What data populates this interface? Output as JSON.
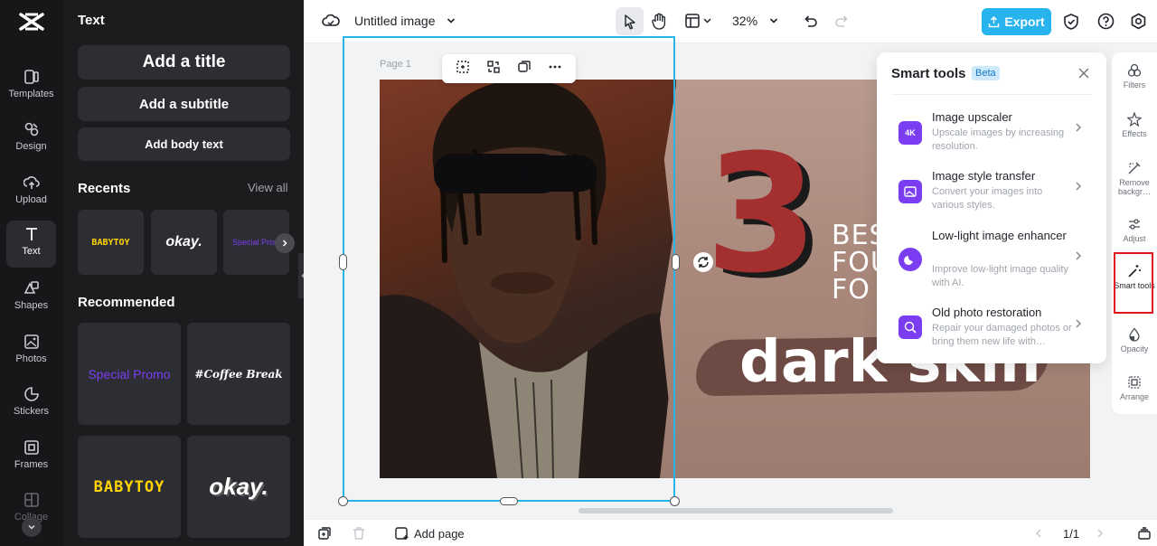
{
  "left_rail": {
    "items": [
      {
        "label": "Templates",
        "icon": "templates-icon"
      },
      {
        "label": "Design",
        "icon": "design-icon"
      },
      {
        "label": "Upload",
        "icon": "upload-icon"
      },
      {
        "label": "Text",
        "icon": "text-icon"
      },
      {
        "label": "Shapes",
        "icon": "shapes-icon"
      },
      {
        "label": "Photos",
        "icon": "photos-icon"
      },
      {
        "label": "Stickers",
        "icon": "stickers-icon"
      },
      {
        "label": "Frames",
        "icon": "frames-icon"
      },
      {
        "label": "Collage",
        "icon": "collage-icon"
      }
    ],
    "active": "Text"
  },
  "text_panel": {
    "title": "Text",
    "add_title": "Add a title",
    "add_subtitle": "Add a subtitle",
    "add_body": "Add body text",
    "recents_title": "Recents",
    "view_all": "View all",
    "recents": [
      "BABYTOY",
      "okay.",
      "Special Promo"
    ],
    "recommended_title": "Recommended",
    "recommended": [
      "Special Promo",
      "#Coffee Break",
      "BABYTOY",
      "okay."
    ]
  },
  "topbar": {
    "doc_title": "Untitled image",
    "zoom": "32%",
    "export_label": "Export"
  },
  "canvas": {
    "page_label": "Page 1",
    "design_number": "3",
    "design_words": [
      "BES",
      "FOU",
      "FO"
    ],
    "design_tagline": "dark skin"
  },
  "smart_tools": {
    "title": "Smart tools",
    "badge": "Beta",
    "tools": [
      {
        "name": "Image upscaler",
        "desc": "Upscale images by increasing resolution.",
        "icon_text": "4K"
      },
      {
        "name": "Image style transfer",
        "desc": "Convert your images into various styles.",
        "icon_text": ""
      },
      {
        "name": "Low-light image enhancer",
        "desc": "Improve low-light image quality with AI.",
        "icon_text": ""
      },
      {
        "name": "Old photo restoration",
        "desc": "Repair your damaged photos or bring them new life with…",
        "icon_text": ""
      }
    ]
  },
  "right_tools": {
    "items": [
      {
        "label": "Filters"
      },
      {
        "label": "Effects"
      },
      {
        "label": "Remove backgr…"
      },
      {
        "label": "Adjust"
      },
      {
        "label": "Smart tools"
      },
      {
        "label": "Opacity"
      },
      {
        "label": "Arrange"
      }
    ]
  },
  "bottombar": {
    "add_page": "Add page",
    "page_count": "1/1"
  },
  "colors": {
    "accent": "#26b3ee",
    "selection": "#27b4e8",
    "highlight": "#e0161f",
    "smart_icon": "#7b3df2"
  }
}
